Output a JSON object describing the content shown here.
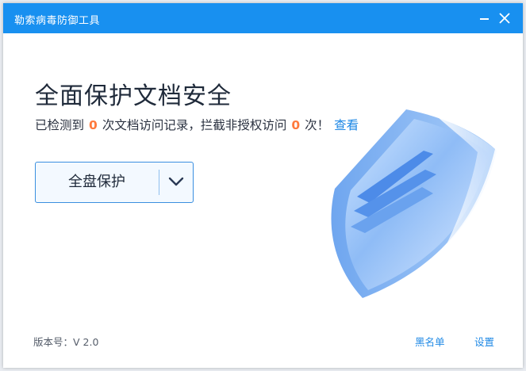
{
  "window": {
    "title": "勒索病毒防御工具"
  },
  "main": {
    "headline": "全面保护文档安全",
    "status": {
      "prefix": "已检测到",
      "detected_count": "0",
      "middle": "次文档访问记录，拦截非授权访问",
      "blocked_count": "0",
      "suffix": "次！",
      "view_link": "查看"
    },
    "scan_button": {
      "label": "全盘保护",
      "dropdown_icon": "chevron-down-icon"
    }
  },
  "footer": {
    "version": "版本号：V 2.0",
    "blacklist": "黑名单",
    "settings": "设置"
  },
  "colors": {
    "titlebar": "#1890f0",
    "accent": "#1e88e5",
    "count": "#ff7a3d"
  }
}
